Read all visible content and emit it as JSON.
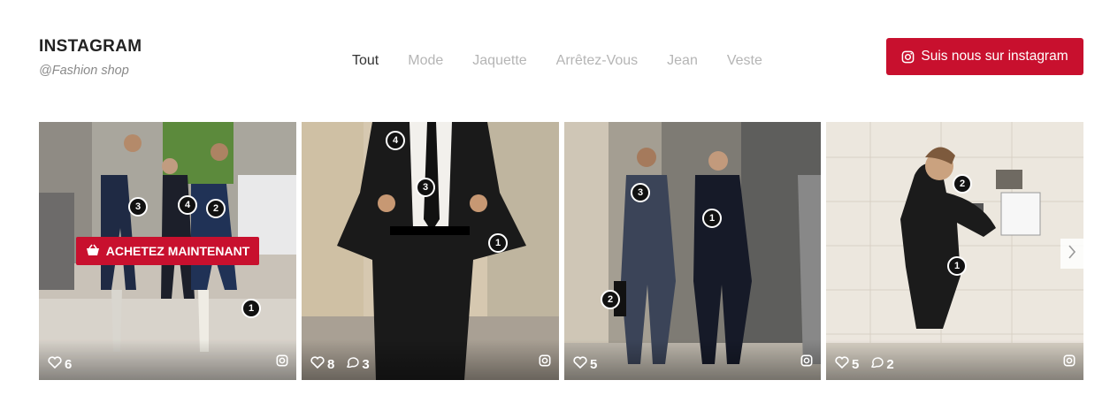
{
  "header": {
    "title": "INSTAGRAM",
    "subtitle": "@Fashion shop"
  },
  "filters": [
    {
      "label": "Tout",
      "active": true
    },
    {
      "label": "Mode",
      "active": false
    },
    {
      "label": "Jaquette",
      "active": false
    },
    {
      "label": "Arrêtez-Vous",
      "active": false
    },
    {
      "label": "Jean",
      "active": false
    },
    {
      "label": "Veste",
      "active": false
    }
  ],
  "follow_button": {
    "label": "Suis nous sur instagram",
    "icon": "instagram-icon",
    "color": "#c8102e"
  },
  "posts": [
    {
      "likes": "6",
      "comments": null,
      "hotspots": [
        "3",
        "4",
        "2",
        "1"
      ],
      "buy_label": "ACHETEZ MAINTENANT"
    },
    {
      "likes": "8",
      "comments": "3",
      "hotspots": [
        "4",
        "3",
        "1"
      ]
    },
    {
      "likes": "5",
      "comments": null,
      "hotspots": [
        "3",
        "1",
        "2"
      ]
    },
    {
      "likes": "5",
      "comments": "2",
      "hotspots": [
        "2",
        "1"
      ]
    }
  ],
  "icons": {
    "like": "heart-icon",
    "comment": "comment-icon",
    "corner": "instagram-icon",
    "buy": "basket-icon",
    "next": "chevron-right-icon"
  },
  "colors": {
    "accent": "#c8102e",
    "text_dark": "#222222",
    "text_muted": "#b5b5b5"
  }
}
